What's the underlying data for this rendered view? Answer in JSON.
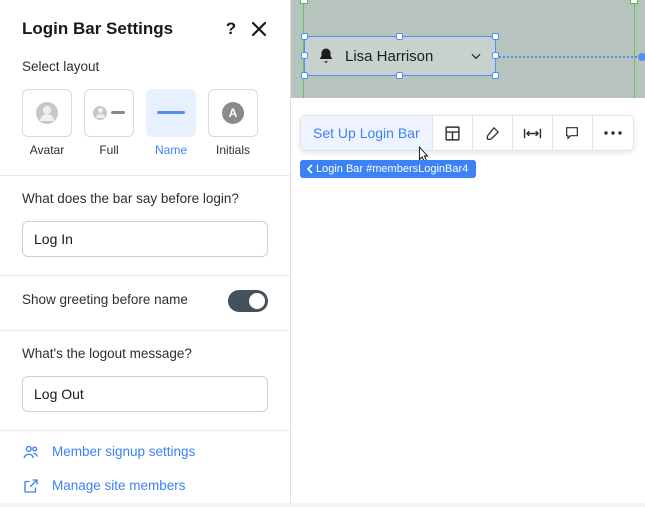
{
  "panel": {
    "title": "Login Bar Settings",
    "layout_label": "Select layout",
    "layouts": [
      {
        "id": "avatar",
        "caption": "Avatar"
      },
      {
        "id": "full",
        "caption": "Full"
      },
      {
        "id": "name",
        "caption": "Name"
      },
      {
        "id": "initials",
        "caption": "Initials",
        "glyph": "A"
      }
    ],
    "before_login_label": "What does the bar say before login?",
    "before_login_value": "Log In",
    "greeting_label": "Show greeting before name",
    "logout_label": "What's the logout message?",
    "logout_value": "Log Out",
    "link_signup": "Member signup settings",
    "link_manage": "Manage site members"
  },
  "canvas": {
    "widget_name": "Lisa Harrison",
    "toolbar_primary": "Set Up Login Bar",
    "tag_text": "Login Bar #membersLoginBar4"
  },
  "colors": {
    "accent": "#3b82f6"
  }
}
